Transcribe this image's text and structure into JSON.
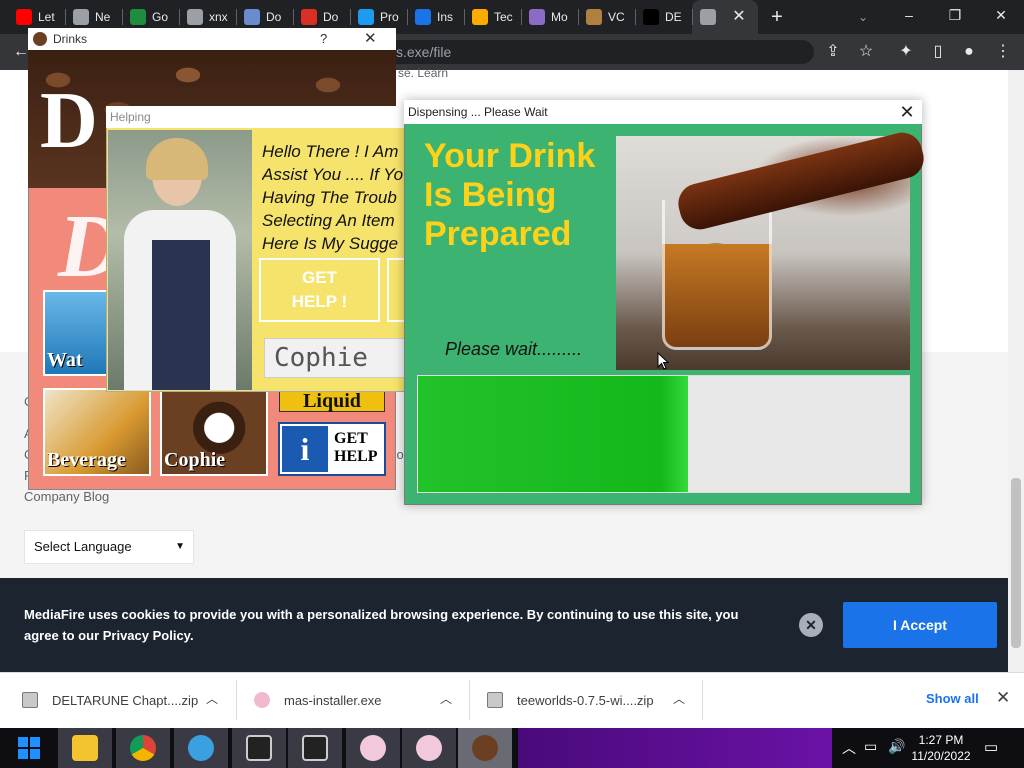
{
  "browser": {
    "tabs": [
      {
        "label": "Let",
        "color": "#ff0000"
      },
      {
        "label": "Ne",
        "color": "#9aa0a6"
      },
      {
        "label": "Go",
        "color": "#1e8e3e"
      },
      {
        "label": "xnx",
        "color": "#9aa0a6"
      },
      {
        "label": "Do",
        "color": "#6a8ccf"
      },
      {
        "label": "Do",
        "color": "#d93025"
      },
      {
        "label": "Pro",
        "color": "#1d9bf0"
      },
      {
        "label": "Ins",
        "color": "#1a73e8"
      },
      {
        "label": "Tec",
        "color": "#f9ab00"
      },
      {
        "label": "Mo",
        "color": "#8a6bc6"
      },
      {
        "label": "VC",
        "color": "#b08040"
      },
      {
        "label": "DE",
        "color": "#000000"
      },
      {
        "label": "",
        "color": "#9aa0a6"
      }
    ],
    "address": "s.exe/file",
    "page_snippet": "se. Learn"
  },
  "page": {
    "footer_links": [
      "C",
      "A",
      "C",
      "F",
      "Company Blog"
    ],
    "footer_partial": "co",
    "select_language": "Select Language",
    "cookie_text": "MediaFire uses cookies to provide you with a personalized browsing experience. By continuing to use this site, you agree to our Privacy Policy.",
    "cookie_accept": "I Accept"
  },
  "downloads": {
    "items": [
      {
        "name": "DELTARUNE Chapt....zip"
      },
      {
        "name": "mas-installer.exe"
      },
      {
        "name": "teeworlds-0.7.5-wi....zip"
      }
    ],
    "show_all": "Show all"
  },
  "drinks_window": {
    "title": "Drinks",
    "help": "?",
    "tiles": [
      {
        "caption": "Wat"
      },
      {
        "caption": "Beverage"
      },
      {
        "caption": "Cophie"
      }
    ],
    "liquid_label": "Liquid",
    "get_help": "GET HELP"
  },
  "helping_window": {
    "title": "Helping",
    "message_lines": [
      "Hello There ! I Am",
      "Assist You .... If Yo",
      "Having The Troub",
      "Selecting An Item",
      "Here Is My Sugge"
    ],
    "get_help_button": "GET\nHELP !",
    "input_value": "Cophie"
  },
  "dispensing_window": {
    "title": "Dispensing ... Please Wait",
    "heading": "Your Drink Is Being Prepared",
    "wait_text": "Please wait.........",
    "progress": 0.55
  },
  "taskbar": {
    "time": "1:27 PM",
    "date": "11/20/2022"
  }
}
